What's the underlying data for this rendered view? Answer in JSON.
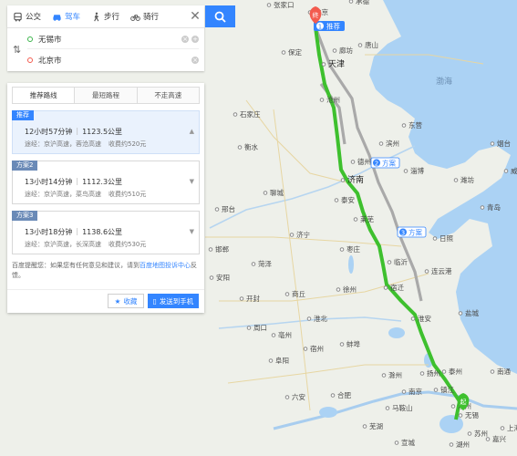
{
  "modes": [
    {
      "label": "公交",
      "icon": "bus-icon"
    },
    {
      "label": "驾车",
      "icon": "car-icon"
    },
    {
      "label": "步行",
      "icon": "walk-icon"
    },
    {
      "label": "骑行",
      "icon": "bike-icon"
    }
  ],
  "close_label": "✕",
  "origin": "无锡市",
  "destination": "北京市",
  "tabs": [
    "推荐路线",
    "最短路程",
    "不走高速"
  ],
  "plans": [
    {
      "tag": "推荐",
      "time": "12小时57分钟",
      "distance": "1123.5公里",
      "via": "途经：京沪高速，蓉沧高速",
      "toll": "收费约520元"
    },
    {
      "tag": "方案2",
      "time": "13小时14分钟",
      "distance": "1112.3公里",
      "via": "途经：京沪高速，菜鸟高速",
      "toll": "收费约510元"
    },
    {
      "tag": "方案3",
      "time": "13小时18分钟",
      "distance": "1138.6公里",
      "via": "途经：京沪高速，长深高速",
      "toll": "收费约530元"
    }
  ],
  "tip": {
    "prefix": "百度提醒您：如果您有任何意见和建议，请到",
    "link": "百度地图投诉中心",
    "suffix": "反馈。"
  },
  "actions": {
    "favorite": "收藏",
    "send_phone": "发送到手机"
  },
  "map": {
    "route_labels": [
      "推荐",
      "方案",
      "方案"
    ],
    "route_numbers": [
      "1",
      "2",
      "3"
    ],
    "start_marker": "起",
    "end_marker": "终",
    "sea_label": "渤海",
    "cities": [
      "天津",
      "廊坊",
      "石家庄",
      "济南",
      "泰安",
      "沧州",
      "德州",
      "淄博",
      "滨州",
      "潍坊",
      "临沂",
      "徐州",
      "连云港",
      "淮安",
      "盐城",
      "泰州",
      "南京",
      "镇江",
      "常州",
      "无锡",
      "合肥",
      "宿州",
      "济宁",
      "枣庄",
      "日照",
      "聊城",
      "衡水",
      "邢台",
      "邯郸",
      "安阳",
      "菏泽",
      "商丘",
      "亳州",
      "蚌埠",
      "滁州",
      "扬州",
      "苏州",
      "湖州",
      "芜湖",
      "宿迁",
      "莱芜",
      "东营",
      "北京",
      "保定",
      "唐山",
      "开封",
      "周口",
      "阜阳",
      "淮北",
      "六安",
      "马鞍山",
      "上海",
      "南通",
      "青岛",
      "烟台",
      "承德",
      "张家口",
      "威海",
      "嘉兴",
      "宣城"
    ]
  },
  "colors": {
    "accent": "#3385ff",
    "route_main": "#3ac230",
    "route_alt": "#a8a8a8",
    "sea": "#aad3f6"
  }
}
